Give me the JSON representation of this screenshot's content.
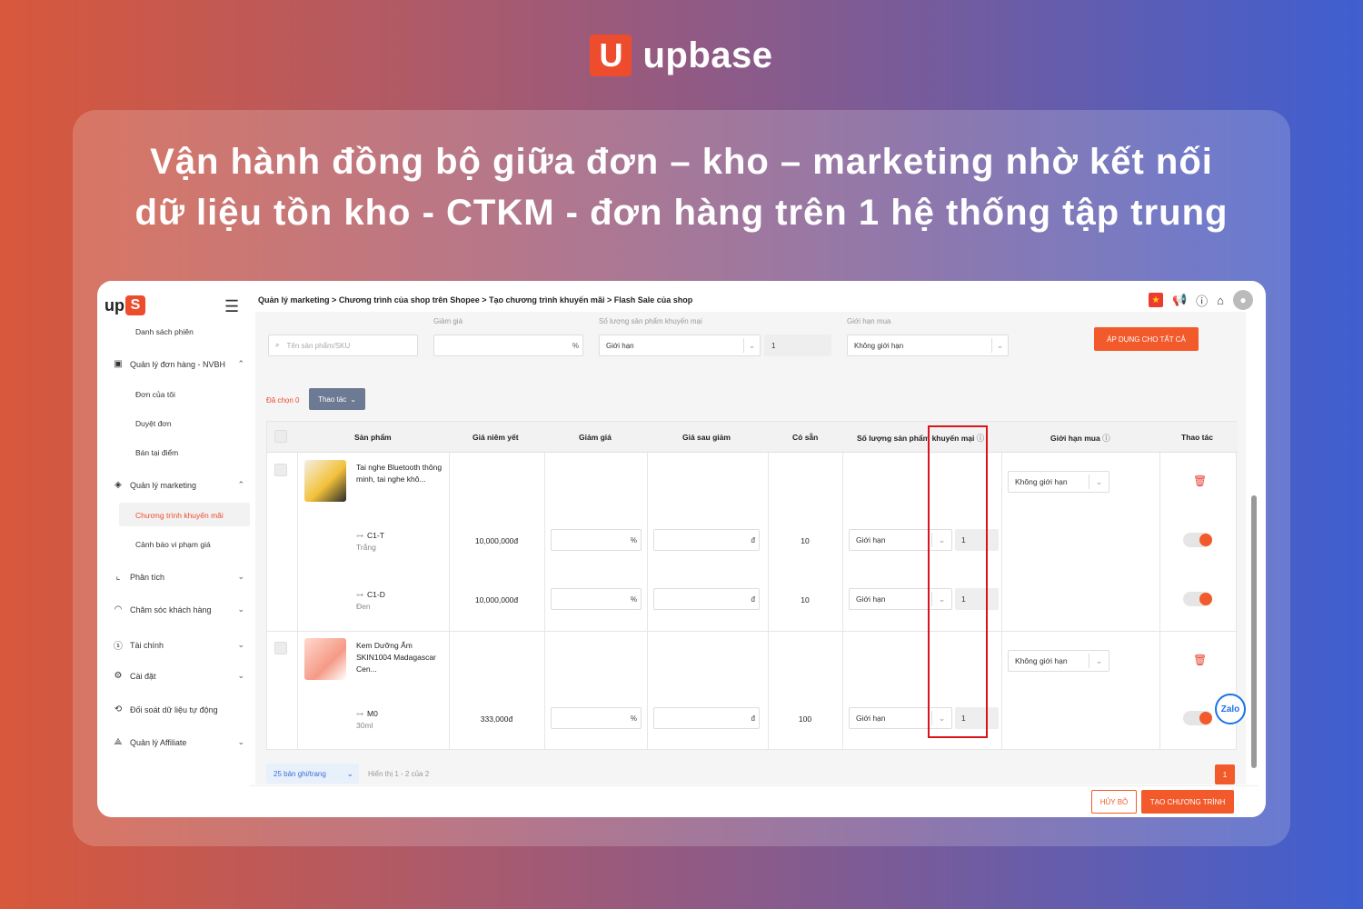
{
  "brand": {
    "logo_letter": "U",
    "name": "upbase"
  },
  "headline": {
    "line1": "Vận hành đồng bộ giữa đơn – kho – marketing nhờ kết nối",
    "line2": "dữ liệu tồn kho - CTKM - đơn hàng trên 1 hệ thống tập trung"
  },
  "app": {
    "logo_text": "up",
    "logo_mark": "S",
    "sidebar": {
      "top_item": "Danh sách phiên",
      "orders_section": "Quản lý đơn hàng - NVBH",
      "orders_sub": [
        "Đơn của tôi",
        "Duyệt đơn",
        "Bán tại điểm"
      ],
      "marketing_section": "Quản lý marketing",
      "marketing_sub": [
        "Chương trình khuyến mãi",
        "Cảnh báo vi phạm giá"
      ],
      "sections": [
        "Phân tích",
        "Chăm sóc khách hàng",
        "Tài chính",
        "Cài đặt",
        "Đối soát dữ liệu tự động",
        "Quản lý Affiliate"
      ]
    },
    "breadcrumb": [
      "Quản lý marketing",
      "Chương trình của shop trên Shopee",
      "Tạo chương trình khuyến mãi",
      "Flash Sale của shop"
    ],
    "filters": {
      "search_placeholder": "Tên sản phẩm/SKU",
      "discount_label": "Giảm giá",
      "discount_suffix": "%",
      "promo_qty_label": "Số lượng sản phẩm khuyến mại",
      "promo_qty_select": "Giới hạn",
      "promo_qty_value": "1",
      "limit_label": "Giới hạn mua",
      "limit_select": "Không giới hạn",
      "apply_all": "ÁP DỤNG CHO TẤT CẢ"
    },
    "selected_text": "Đã chọn 0",
    "actions_button": "Thao tác",
    "table": {
      "headers": [
        "Sản phẩm",
        "Giá niêm yết",
        "Giảm giá",
        "Giá sau giảm",
        "Có sẵn",
        "Số lượng sản phẩm khuyến mại",
        "Giới hạn mua",
        "Thao tác"
      ],
      "percent": "%",
      "currency": "đ",
      "products": [
        {
          "title": "Tai nghe Bluetooth thông minh, tai nghe khô...",
          "limit": "Không giới hạn",
          "variants": [
            {
              "code": "C1-T",
              "name": "Trắng",
              "price": "10,000,000đ",
              "stock": "10",
              "qty_mode": "Giới hạn",
              "qty": "1"
            },
            {
              "code": "C1-D",
              "name": "Đen",
              "price": "10,000,000đ",
              "stock": "10",
              "qty_mode": "Giới hạn",
              "qty": "1"
            }
          ]
        },
        {
          "title": "Kem Dưỡng Ẩm SKIN1004 Madagascar Cen...",
          "limit": "Không giới hạn",
          "variants": [
            {
              "code": "M0",
              "name": "30ml",
              "price": "333,000đ",
              "stock": "100",
              "qty_mode": "Giới hạn",
              "qty": "1"
            }
          ]
        }
      ]
    },
    "pagination": {
      "per_page": "25 bản ghi/trang",
      "info": "Hiển thị 1 - 2 của 2",
      "page": "1"
    },
    "footer": {
      "cancel": "HỦY BỎ",
      "create": "TẠO CHƯƠNG TRÌNH"
    },
    "zalo": "Zalo"
  },
  "colors": {
    "accent": "#f25a2b",
    "highlight": "#d9141a",
    "brand": "#ee4d2d"
  }
}
